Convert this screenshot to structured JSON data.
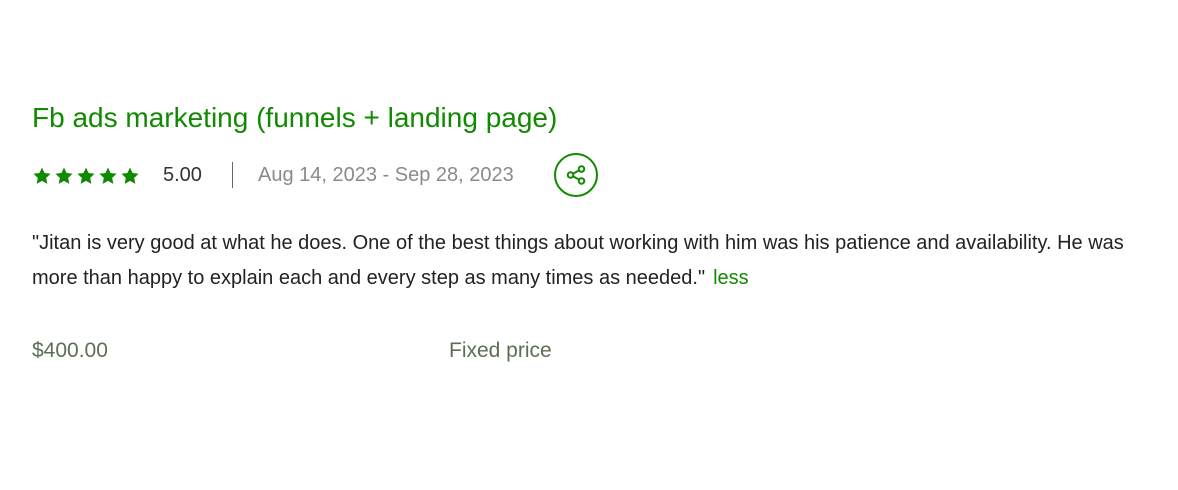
{
  "job": {
    "title": "Fb ads marketing (funnels + landing page)",
    "rating": "5.00",
    "stars_filled": 5,
    "stars_total": 5,
    "date_range": "Aug 14, 2023 - Sep 28, 2023",
    "feedback": "\"Jitan is very good at what he does. One of the best things about working with him was his patience and availability. He was more than happy to explain each and every step as many times as needed.\"",
    "less_label": "less",
    "price": "$400.00",
    "price_type": "Fixed price"
  },
  "icons": {
    "star": "star-icon",
    "share": "share-icon"
  },
  "colors": {
    "accent": "#108a00",
    "muted": "#5e6d55",
    "date": "#8a8a8a",
    "text": "#222222"
  }
}
